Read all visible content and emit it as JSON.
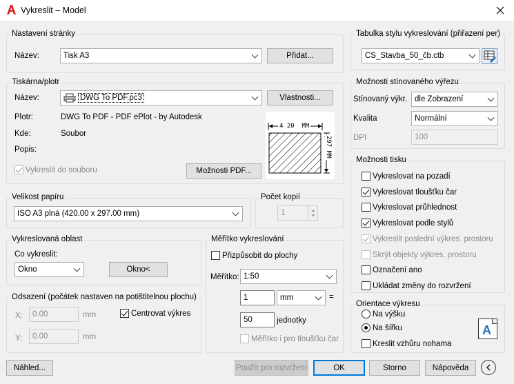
{
  "window": {
    "title": "Vykreslit – Model"
  },
  "page_setup": {
    "group_label": "Nastavení stránky",
    "name_label": "Název:",
    "name_value": "Tisk A3",
    "add_button": "Přidat..."
  },
  "printer": {
    "group_label": "Tiskárna/plotr",
    "name_label": "Název:",
    "name_value": "DWG To PDF.pc3",
    "properties_button": "Vlastnosti...",
    "plotter_label": "Plotr:",
    "plotter_value": "DWG To PDF - PDF ePlot - by Autodesk",
    "where_label": "Kde:",
    "where_value": "Soubor",
    "description_label": "Popis:",
    "plot_to_file_label": "Vykreslit do souboru",
    "plot_to_file_checked": true,
    "pdf_options_button": "Možnosti PDF...",
    "preview_width_label": "4 20  MM",
    "preview_height_label": "297 MM"
  },
  "paper_size": {
    "group_label": "Velikost papíru",
    "value": "ISO A3 plná (420.00 x 297.00 mm)"
  },
  "copies": {
    "group_label": "Počet kopií",
    "value": "1"
  },
  "plot_area": {
    "group_label": "Vykreslovaná oblast",
    "what_label": "Co vykreslit:",
    "what_value": "Okno",
    "window_button": "Okno<"
  },
  "plot_offset": {
    "group_label": "Odsazení (počátek nastaven na potištitelnou plochu)",
    "x_label": "X:",
    "x_value": "0.00",
    "x_unit": "mm",
    "y_label": "Y:",
    "y_value": "0.00",
    "y_unit": "mm",
    "center_label": "Centrovat výkres",
    "center_checked": true
  },
  "plot_scale": {
    "group_label": "Měřítko vykreslování",
    "fit_label": "Přizpůsobit do plochy",
    "fit_checked": false,
    "scale_label": "Měřítko:",
    "scale_value": "1:50",
    "value1": "1",
    "unit_value": "mm",
    "equals": "=",
    "value2": "50",
    "units_label": "jednotky",
    "scale_lineweights_label": "Měřítko i pro tloušťku čar",
    "scale_lineweights_checked": false
  },
  "plot_style_table": {
    "group_label": "Tabulka stylu vykreslování (přiřazení per)",
    "value": "CS_Stavba_50_čb.ctb"
  },
  "shaded_viewport": {
    "group_label": "Možnosti stínovaného výřezu",
    "shade_label": "Stínovaný výkr.",
    "shade_value": "dle Zobrazení",
    "quality_label": "Kvalita",
    "quality_value": "Normální",
    "dpi_label": "DPI",
    "dpi_value": "100"
  },
  "plot_options": {
    "group_label": "Možnosti tisku",
    "items": [
      {
        "label": "Vykreslovat na pozadí",
        "checked": false,
        "disabled": false
      },
      {
        "label": "Vykreslovat tloušťku čar",
        "checked": true,
        "disabled": false
      },
      {
        "label": "Vykreslovat průhlednost",
        "checked": false,
        "disabled": false
      },
      {
        "label": "Vykreslovat podle stylů",
        "checked": true,
        "disabled": false
      },
      {
        "label": "Vykreslit poslední výkres. prostoru",
        "checked": true,
        "disabled": true
      },
      {
        "label": "Skrýt objekty výkres. prostoru",
        "checked": false,
        "disabled": true
      },
      {
        "label": "Označení ano",
        "checked": false,
        "disabled": false
      },
      {
        "label": "Ukládat změny do rozvržení",
        "checked": false,
        "disabled": false
      }
    ]
  },
  "orientation": {
    "group_label": "Orientace výkresu",
    "portrait_label": "Na výšku",
    "landscape_label": "Na šířku",
    "selected": "landscape",
    "upside_down_label": "Kreslit vzhůru nohama",
    "upside_down_checked": false,
    "icon_letter": "A"
  },
  "footer": {
    "preview_button": "Náhled...",
    "apply_button": "Použít pro rozvržení",
    "ok_button": "OK",
    "cancel_button": "Storno",
    "help_button": "Nápověda"
  },
  "colors": {
    "accent": "#0078d7",
    "title_red": "#d6211e",
    "window_bg": "#f0f0f0"
  }
}
